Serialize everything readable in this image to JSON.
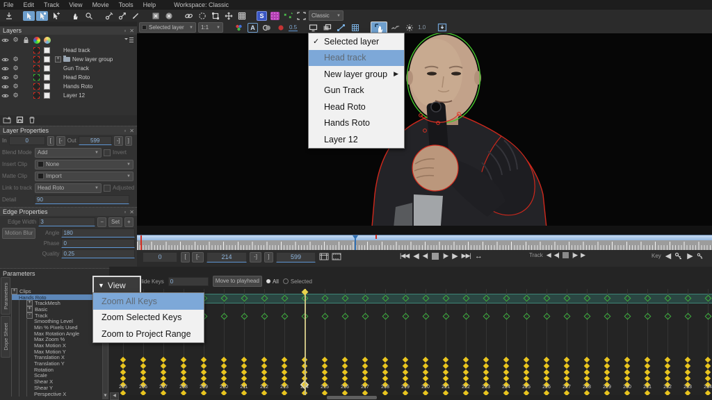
{
  "menu_bar": {
    "items": [
      "File",
      "Edit",
      "Track",
      "View",
      "Movie",
      "Tools",
      "Help"
    ],
    "workspace": "Workspace: Classic"
  },
  "toolbar_top": {
    "icons": [
      "save-icon",
      "pointer-icon",
      "pointer-add-icon",
      "pointer-plus-icon",
      "hand-icon",
      "magnifier-icon",
      "pen-x-icon",
      "pen-arrow-icon",
      "pen-brush-icon",
      "rect-x-icon",
      "ellipse-x-icon",
      "link-icon",
      "lasso-icon",
      "transform-icon",
      "move-icon",
      "grid-icon",
      "stabilize-icon",
      "insert-module-icon",
      "remove-module-icon",
      "canvas-icon"
    ],
    "selected_icons": [
      "pointer-icon",
      "pointer-add-icon"
    ],
    "classic_select": "Classic"
  },
  "toolbar_view": {
    "layer_select": "Selected layer",
    "zoom_select": "1:1",
    "opacity_value": "0.5",
    "gain_value": "1.0",
    "icons": [
      "color-channels-icon",
      "alpha-icon",
      "matte-view-icon",
      "red-channel-icon",
      "monitor-icon",
      "proxy-icon",
      "path-icon",
      "grid-overlay-icon",
      "pick-layer-icon",
      "motion-path-icon",
      "brightness-icon",
      "clip-icon"
    ]
  },
  "layers_panel": {
    "title": "Layers",
    "header_icons": [
      "eye-icon",
      "gear-icon",
      "lock-icon",
      "color-wheel-icon",
      "color-circle-icon",
      "layer-menu-icon"
    ],
    "rows": [
      {
        "label": "Head  track",
        "eye": false,
        "gear": false,
        "swatch": "red",
        "matte": true,
        "group": false
      },
      {
        "label": "New layer group",
        "eye": true,
        "gear": true,
        "swatch": "red",
        "matte": true,
        "group": true,
        "expander": "+"
      },
      {
        "label": "Gun Track",
        "eye": true,
        "gear": true,
        "swatch": "red",
        "matte": true,
        "group": false
      },
      {
        "label": "Head Roto",
        "eye": true,
        "gear": true,
        "swatch": "green",
        "matte": true,
        "group": false
      },
      {
        "label": "Hands Roto",
        "eye": true,
        "gear": true,
        "swatch": "red",
        "matte": true,
        "group": false
      },
      {
        "label": "Layer 12",
        "eye": true,
        "gear": true,
        "swatch": "red",
        "matte": true,
        "group": false
      }
    ],
    "action_icons": [
      "new-layer-icon",
      "export-layer-icon",
      "trash-icon"
    ]
  },
  "layer_properties": {
    "title": "Layer Properties",
    "in_label": "In",
    "in_value": "0",
    "out_label": "Out",
    "out_value": "599",
    "bracket_open": "[",
    "bracket_in": "[-",
    "bracket_out": "-]",
    "bracket_close": "]",
    "blend_label": "Blend Mode",
    "blend_value": "Add",
    "invert_label": "Invert",
    "insert_label": "Insert Clip",
    "insert_value": "None",
    "matte_label": "Matte Clip",
    "matte_value": "Import",
    "link_label": "Link to track",
    "link_value": "Head Roto",
    "adjusted_label": "Adjusted",
    "detail_label": "Detail",
    "detail_value": "90"
  },
  "edge_properties": {
    "title": "Edge Properties",
    "width_label": "Edge Width",
    "width_value": "3",
    "minus_btn": "−",
    "set_btn": "Set",
    "plus_btn": "+",
    "motion_blur_btn": "Motion Blur",
    "angle_label": "Angle",
    "angle_value": "180",
    "phase_label": "Phase",
    "phase_value": "0",
    "quality_label": "Quality",
    "quality_value": "0.25"
  },
  "parameters_panel": {
    "title": "Parameters",
    "tabs": [
      "Parameters",
      "Dope Sheet"
    ],
    "tree": [
      {
        "label": "Clips",
        "exp": "+",
        "indent": 0
      },
      {
        "label": "Hands Roto",
        "indent": 1,
        "selected": true
      },
      {
        "label": "TrackMesh",
        "exp": "+",
        "indent": 2
      },
      {
        "label": "Basic",
        "exp": "+",
        "indent": 2
      },
      {
        "label": "Track",
        "exp": "-",
        "indent": 2
      },
      {
        "label": "Smoothing Level",
        "indent": 3
      },
      {
        "label": "Min % Pixels Used",
        "indent": 3
      },
      {
        "label": "Max Rotation Angle",
        "indent": 3
      },
      {
        "label": "Max Zoom %",
        "indent": 3
      },
      {
        "label": "Max Motion X",
        "indent": 3
      },
      {
        "label": "Max Motion Y",
        "indent": 3
      },
      {
        "label": "Translation X",
        "indent": 3
      },
      {
        "label": "Translation Y",
        "indent": 3
      },
      {
        "label": "Rotation",
        "indent": 3
      },
      {
        "label": "Scale",
        "indent": 3
      },
      {
        "label": "Shear X",
        "indent": 3
      },
      {
        "label": "Shear Y",
        "indent": 3
      },
      {
        "label": "Perspective X",
        "indent": 3
      }
    ]
  },
  "layer_menu": {
    "items": [
      {
        "label": "Selected layer",
        "checked": true
      },
      {
        "label": "Head  track",
        "highlighted": true
      },
      {
        "label": "New layer group",
        "submenu": true
      },
      {
        "label": "Gun Track"
      },
      {
        "label": "Head Roto"
      },
      {
        "label": "Hands Roto"
      },
      {
        "label": "Layer 12"
      }
    ]
  },
  "view_menu": {
    "button": "View",
    "items": [
      {
        "label": "Zoom All Keys",
        "highlighted": true
      },
      {
        "label": "Zoom Selected Keys"
      },
      {
        "label": "Zoom to Project Range"
      }
    ]
  },
  "timeline": {
    "in_value": "0",
    "range_value": "214",
    "out_value": "599",
    "track_label": "Track",
    "key_label": "Key"
  },
  "dopesheet": {
    "slide_keys_label": "Slide Keys",
    "slide_keys_value": "0",
    "move_button": "Move to playhead",
    "all_label": "All",
    "selected_label": "Selected",
    "frames": [
      205,
      206,
      207,
      208,
      209,
      210,
      211,
      212,
      213,
      214,
      215,
      216,
      217,
      218,
      219,
      220,
      221,
      222,
      223,
      224,
      225,
      226,
      227,
      228,
      229,
      230,
      231,
      232,
      233,
      234
    ],
    "playhead_frame": 214,
    "green_key_rows": 2,
    "yellow_key_rows": 6
  },
  "colors": {
    "accent_blue": "#7da8d8",
    "selected_tool_blue": "#6e9fcd",
    "key_yellow": "#e9c51f",
    "key_green": "#3fae3f",
    "spline_red": "#d22a1e",
    "spline_green": "#46c52c",
    "timeline_blue": "#8fb5e0",
    "stabilize_badge": "#3a57c4",
    "insert_badge": "#b13fb1"
  }
}
